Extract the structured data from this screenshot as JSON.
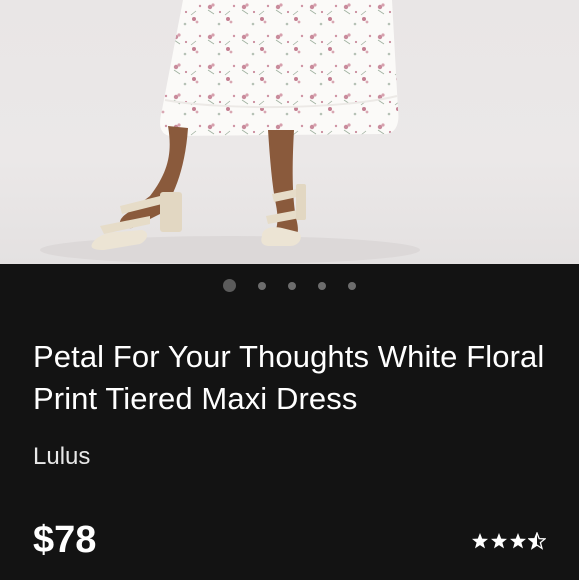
{
  "product": {
    "title": "Petal For Your Thoughts White Floral Print Tiered Maxi Dress",
    "brand": "Lulus",
    "price": "$78",
    "rating": 3.5,
    "rating_max": 5
  },
  "carousel": {
    "image_count": 5,
    "active_index": 0,
    "image_icon": "product-photo-floral-dress-sandals"
  },
  "colors": {
    "background": "#131313",
    "dot_inactive": "#6d6d6d",
    "dot_active": "#5b5b5b"
  }
}
